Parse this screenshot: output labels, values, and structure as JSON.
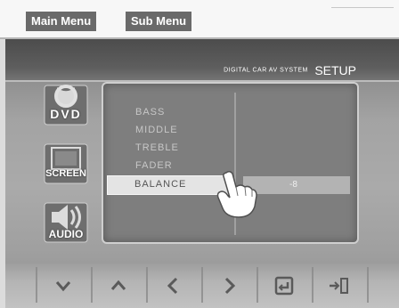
{
  "breadcrumb": {
    "main_menu": "Main Menu",
    "sub_menu": "Sub Menu"
  },
  "header": {
    "title_small": "DIGITAL CAR AV SYSTEM",
    "title_big": "SETUP"
  },
  "sidebar": {
    "items": [
      {
        "label": "DVD",
        "icon": "disc-icon"
      },
      {
        "label": "SCREEN",
        "icon": "monitor-icon"
      },
      {
        "label": "AUDIO",
        "icon": "speaker-icon"
      }
    ]
  },
  "audio_menu": {
    "items": [
      "BASS",
      "MIDDLE",
      "TREBLE",
      "FADER",
      "BALANCE"
    ],
    "selected": "BALANCE",
    "selected_value": "-8"
  },
  "bottom_nav": {
    "buttons": [
      {
        "icon": "chevron-down-icon"
      },
      {
        "icon": "chevron-up-icon"
      },
      {
        "icon": "chevron-left-icon"
      },
      {
        "icon": "chevron-right-icon"
      },
      {
        "icon": "enter-icon"
      },
      {
        "icon": "exit-icon"
      }
    ]
  },
  "colors": {
    "breadcrumb_bg": "#6a6a6a",
    "header_bg": "#4c4c4c",
    "panel_bg": "#7e7e7e",
    "selected_bg": "#e4e4e4"
  }
}
